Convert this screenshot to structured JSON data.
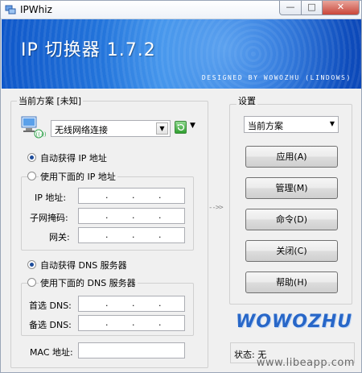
{
  "window": {
    "title": "IPWhiz",
    "min_label": "—",
    "max_label": "□",
    "close_label": "✕"
  },
  "banner": {
    "title": "IP 切换器 1.7.2",
    "credit": "DESIGNED BY WOWOZHU (LINDOWS)"
  },
  "scheme": {
    "group_label": "当前方案 [未知]",
    "adapter": "无线网络连接",
    "ip_auto_label": "自动获得 IP 地址",
    "ip_manual_label": "使用下面的 IP 地址",
    "ip_auto_selected": true,
    "ip_address_label": "IP 地址:",
    "subnet_label": "子网掩码:",
    "gateway_label": "网关:",
    "dns_auto_label": "自动获得 DNS 服务器",
    "dns_manual_label": "使用下面的 DNS 服务器",
    "dns_auto_selected": true,
    "dns_primary_label": "首选 DNS:",
    "dns_secondary_label": "备选 DNS:",
    "mac_label": "MAC 地址:",
    "ip_dot": "."
  },
  "settings": {
    "group_label": "设置",
    "scheme_select": "当前方案",
    "buttons": {
      "apply": "应用(A)",
      "manage": "管理(M)",
      "command": "命令(D)",
      "close": "关闭(C)",
      "help": "帮助(H)"
    },
    "logo": "WOWOZHU",
    "status": "状态: 无"
  },
  "middle_arrow": "-->>",
  "watermark": "www.libeapp.com",
  "colors": {
    "banner": "#1f6fdc",
    "logo": "#2867c8",
    "radio_dot": "#1e4d9b"
  }
}
